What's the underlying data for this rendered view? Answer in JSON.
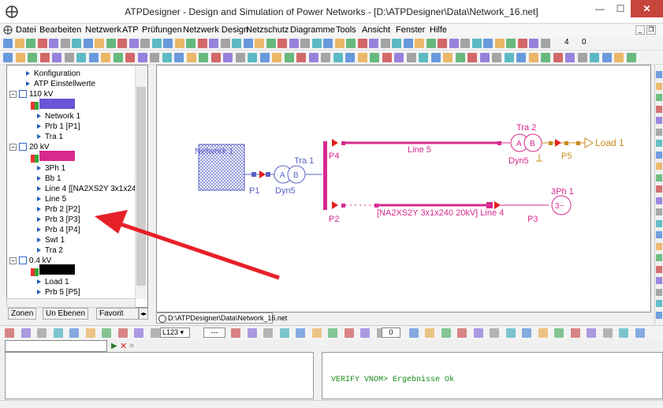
{
  "window": {
    "title": "ATPDesigner - Design and Simulation of Power Networks - [D:\\ATPDesigner\\Data\\Network_16.net]"
  },
  "menu": [
    "Datei",
    "Bearbeiten",
    "Netzwerk",
    "ATP",
    "Prüfungen",
    "Netzwerk Design",
    "Netzschutz",
    "Diagramme",
    "Tools",
    "Ansicht",
    "Fenster",
    "Hilfe"
  ],
  "toolbar": {
    "value_4": "4",
    "value_0": "0",
    "combo_value": "L123",
    "combo_dashes": "---",
    "num_value": "0"
  },
  "tree": {
    "konfiguration": "Konfiguration",
    "einstellwerte": "ATP Einstellwerte",
    "zone_110": "110 kV",
    "items_110": [
      "Network 1",
      "Prb 1 [P1]",
      "Tra 1"
    ],
    "zone_20": "20 kV",
    "items_20": [
      "3Ph 1",
      "Bb 1",
      "Line 4 [[NA2XS2Y 3x1x24",
      "Line 5",
      "Prb 2 [P2]",
      "Prb 3 [P3]",
      "Prb 4 [P4]",
      "Swt 1",
      "Tra 2"
    ],
    "zone_04": "0.4 kV",
    "items_04": [
      "Load 1",
      "Prb 5 [P5]"
    ],
    "colors": {
      "zone_110": "#6a55d6",
      "zone_20": "#d62a8e",
      "zone_04": "#000000"
    }
  },
  "bottom_tabs": [
    "Zonen",
    "Un Ebenen",
    "Favorit"
  ],
  "document_tab": "D:\\ATPDesigner\\Data\\Network_16.net",
  "diagram": {
    "network": "Network 1",
    "p1": "P1",
    "tra1": "Tra 1",
    "dyn5a": "Dyn5",
    "a1": "A",
    "b1": "B",
    "p4": "P4",
    "line5": "Line 5",
    "tra2": "Tra 2",
    "a2": "A",
    "b2": "B",
    "dyn5b": "Dyn5",
    "p5": "P5",
    "load": "Load 1",
    "p2": "P2",
    "line4": "[NA2XS2Y 3x1x240 20kV] Line 4",
    "p3": "P3",
    "ph3": "3Ph 1",
    "ph3sym": "3~",
    "colors": {
      "blue": "#5a62c8",
      "magenta": "#d62a8e",
      "orange": "#c98a1a",
      "red": "#e0201c"
    }
  },
  "console": {
    "output": "VERIFY VNOM> Ergebnisse Ok"
  }
}
